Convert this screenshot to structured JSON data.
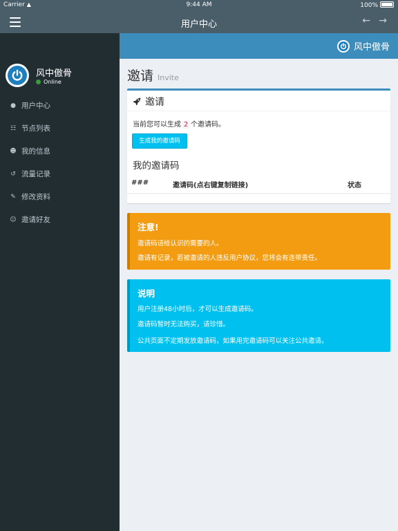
{
  "status_bar": {
    "carrier": "Carrier",
    "time": "9:44 AM",
    "battery": "100%"
  },
  "nav": {
    "title": "用户中心"
  },
  "brand": {
    "name": "风中傲骨"
  },
  "user": {
    "name": "风中傲骨",
    "status": "Online"
  },
  "sidebar": {
    "items": [
      {
        "label": "用户中心",
        "icon": "dashboard-icon"
      },
      {
        "label": "节点列表",
        "icon": "sitemap-icon"
      },
      {
        "label": "我的信息",
        "icon": "user-icon"
      },
      {
        "label": "流量记录",
        "icon": "history-icon"
      },
      {
        "label": "修改资料",
        "icon": "pencil-icon"
      },
      {
        "label": "邀请好友",
        "icon": "users-icon"
      }
    ]
  },
  "page": {
    "title": "邀请",
    "subtitle": "Invite"
  },
  "box": {
    "title": "邀请",
    "text_before": "当前您可以生成",
    "count": "2",
    "text_after": "个邀请码。",
    "button_label": "生成我的邀请码",
    "section_title": "我的邀请码",
    "table_headers": [
      "###",
      "邀请码(点右键复制链接)",
      "状态"
    ]
  },
  "warning": {
    "title": "注意!",
    "lines": [
      "邀请码请给认识的需要的人。",
      "邀请有记录，若被邀请的人违反用户协议，您将会有连带责任。"
    ]
  },
  "info": {
    "title": "说明",
    "lines": [
      "用户注册48小时后，才可以生成邀请码。",
      "邀请码暂时无法购买，请珍惜。",
      "公共页面不定期发放邀请码，如果用完邀请码可以关注公共邀请。"
    ]
  },
  "colors": {
    "sidebar": "#222d32",
    "header": "#3c8dbc",
    "navbar": "#4a5e6a",
    "warning": "#f39c12",
    "info": "#00c0ef"
  }
}
